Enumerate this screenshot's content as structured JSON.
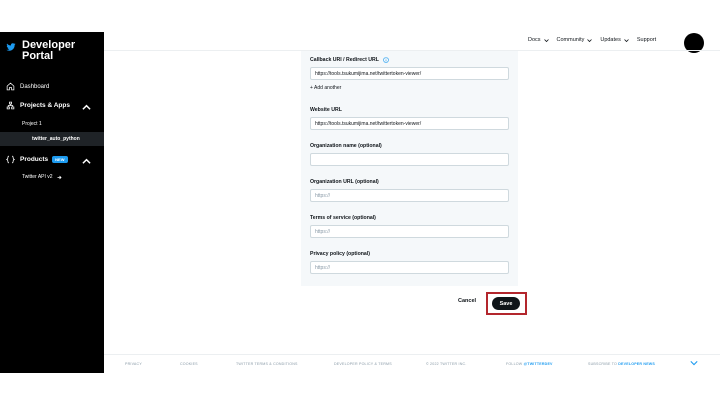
{
  "sidebar": {
    "brand_line1": "Developer",
    "brand_line2": "Portal",
    "dashboard": "Dashboard",
    "projects_apps": "Projects & Apps",
    "project_1": "Project 1",
    "app_name": "twitter_auto_python",
    "products": "Products",
    "products_badge": "NEW",
    "twitter_api": "Twitter API v2"
  },
  "topnav": {
    "docs": "Docs",
    "community": "Community",
    "updates": "Updates",
    "support": "Support"
  },
  "form": {
    "callback_label": "Callback URI / Redirect URL",
    "callback_value": "https://tools.tsukumijima.net/twittertoken-viewer/",
    "add_another": "+ Add another",
    "website_label": "Website URL",
    "website_value": "https://tools.tsukumijima.net/twittertoken-viewer/",
    "org_name_label": "Organization name (optional)",
    "org_name_value": "",
    "org_url_label": "Organization URL (optional)",
    "org_url_placeholder": "https://",
    "tos_label": "Terms of service (optional)",
    "tos_placeholder": "https://",
    "privacy_label": "Privacy policy (optional)",
    "privacy_placeholder": "https://"
  },
  "actions": {
    "cancel": "Cancel",
    "save": "Save"
  },
  "footer": {
    "privacy": "PRIVACY",
    "cookies": "COOKIES",
    "terms": "TWITTER TERMS & CONDITIONS",
    "dev_policy": "DEVELOPER POLICY & TERMS",
    "copyright": "© 2022 TWITTER INC.",
    "follow_prefix": "FOLLOW",
    "follow_handle": "@TWITTERDEV",
    "subscribe_prefix": "SUBSCRIBE TO",
    "subscribe_link": "DEVELOPER NEWS"
  },
  "colors": {
    "sidebar_bg": "#000000",
    "accent": "#1d9bf0",
    "highlight_box": "#b3262d",
    "card_bg": "#f5f8fa"
  }
}
